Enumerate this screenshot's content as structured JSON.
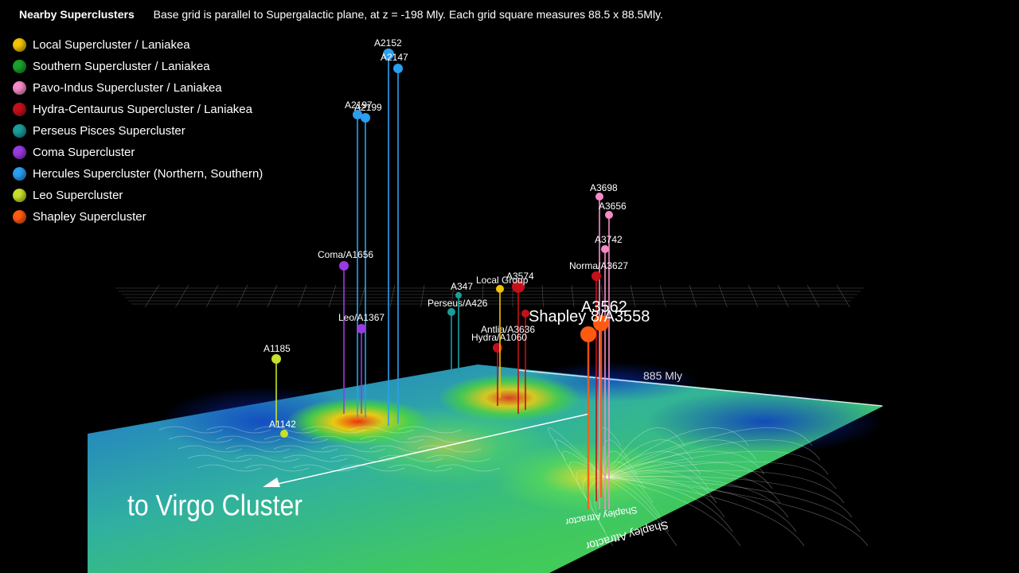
{
  "header": {
    "title": "Nearby Superclusters",
    "description": "Base grid is parallel to Supergalactic plane, at z = -198 Mly. Each grid square measures 88.5 x 88.5Mly."
  },
  "legend": [
    {
      "label": "Local Supercluster / Laniakea",
      "color": "#f2c200"
    },
    {
      "label": "Southern Supercluster / Laniakea",
      "color": "#17a32a"
    },
    {
      "label": "Pavo-Indus Supercluster / Laniakea",
      "color": "#f58ac6"
    },
    {
      "label": "Hydra-Centaurus Supercluster / Laniakea",
      "color": "#c4101a"
    },
    {
      "label": "Perseus Pisces Supercluster",
      "color": "#1a9e9a"
    },
    {
      "label": "Coma Supercluster",
      "color": "#9a3ae0"
    },
    {
      "label": "Hercules Supercluster (Northern, Southern)",
      "color": "#2a9ff0"
    },
    {
      "label": "Leo Supercluster",
      "color": "#c8e02a"
    },
    {
      "label": "Shapley Supercluster",
      "color": "#ff5a10"
    }
  ],
  "scale_label": "885 Mly",
  "direction_label": "to Virgo Cluster",
  "map_labels": {
    "shapley_attractor": "Shapley Attractor",
    "shapley_attractor_2": "Shapley Attractor"
  },
  "clusters": [
    {
      "label": "A2152",
      "color": "#2a9ff0"
    },
    {
      "label": "A2147",
      "color": "#2a9ff0"
    },
    {
      "label": "A2197",
      "color": "#2a9ff0"
    },
    {
      "label": "A2199",
      "color": "#2a9ff0"
    },
    {
      "label": "Coma/A1656",
      "color": "#9a3ae0"
    },
    {
      "label": "Leo/A1367",
      "color": "#9a3ae0"
    },
    {
      "label": "A1185",
      "color": "#c8e02a"
    },
    {
      "label": "A1142",
      "color": "#c8e02a"
    },
    {
      "label": "A3698",
      "color": "#f58ac6"
    },
    {
      "label": "A3656",
      "color": "#f58ac6"
    },
    {
      "label": "A3742",
      "color": "#f58ac6"
    },
    {
      "label": "Norma/A3627",
      "color": "#c4101a"
    },
    {
      "label": "A3574",
      "color": "#c4101a"
    },
    {
      "label": "A3562",
      "color": "#ff5a10"
    },
    {
      "label": "Shapley 8/A3558",
      "color": "#ff5a10"
    },
    {
      "label": "Antlia/A3636",
      "color": "#c4101a"
    },
    {
      "label": "Hydra/A1060",
      "color": "#c4101a"
    },
    {
      "label": "Perseus/A426",
      "color": "#1a9e9a"
    },
    {
      "label": "A347",
      "color": "#1a9e9a"
    },
    {
      "label": "Local Group",
      "color": "#f2c200"
    }
  ]
}
